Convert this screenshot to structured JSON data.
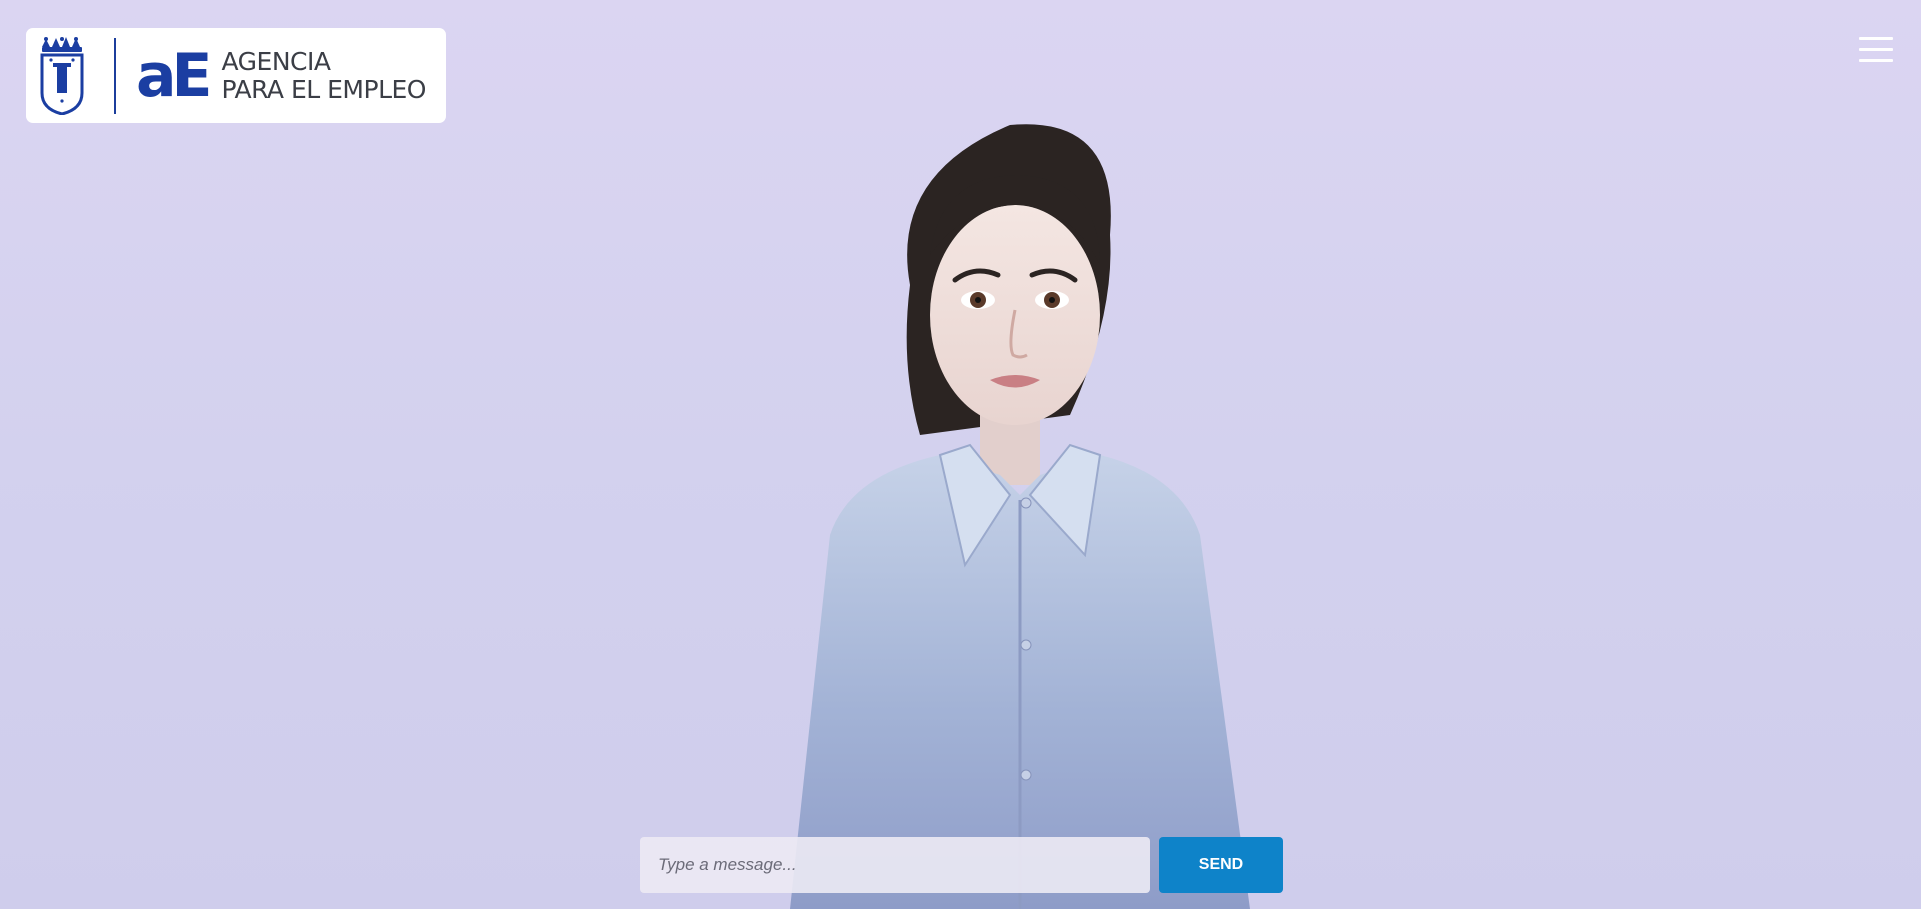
{
  "header": {
    "logo": {
      "brand_mark": "aE",
      "line1": "AGENCIA",
      "line2": "PARA EL EMPLEO",
      "brand_color": "#1b3ea2"
    },
    "menu_icon": "hamburger-menu-icon"
  },
  "avatar": {
    "description_icon": "avatar-3d-woman"
  },
  "chat": {
    "placeholder": "Type a message...",
    "value": "",
    "send_label": "SEND",
    "send_color": "#0e83c9"
  },
  "colors": {
    "background": "#d8d4f0",
    "logo_text": "#3b3e46"
  }
}
